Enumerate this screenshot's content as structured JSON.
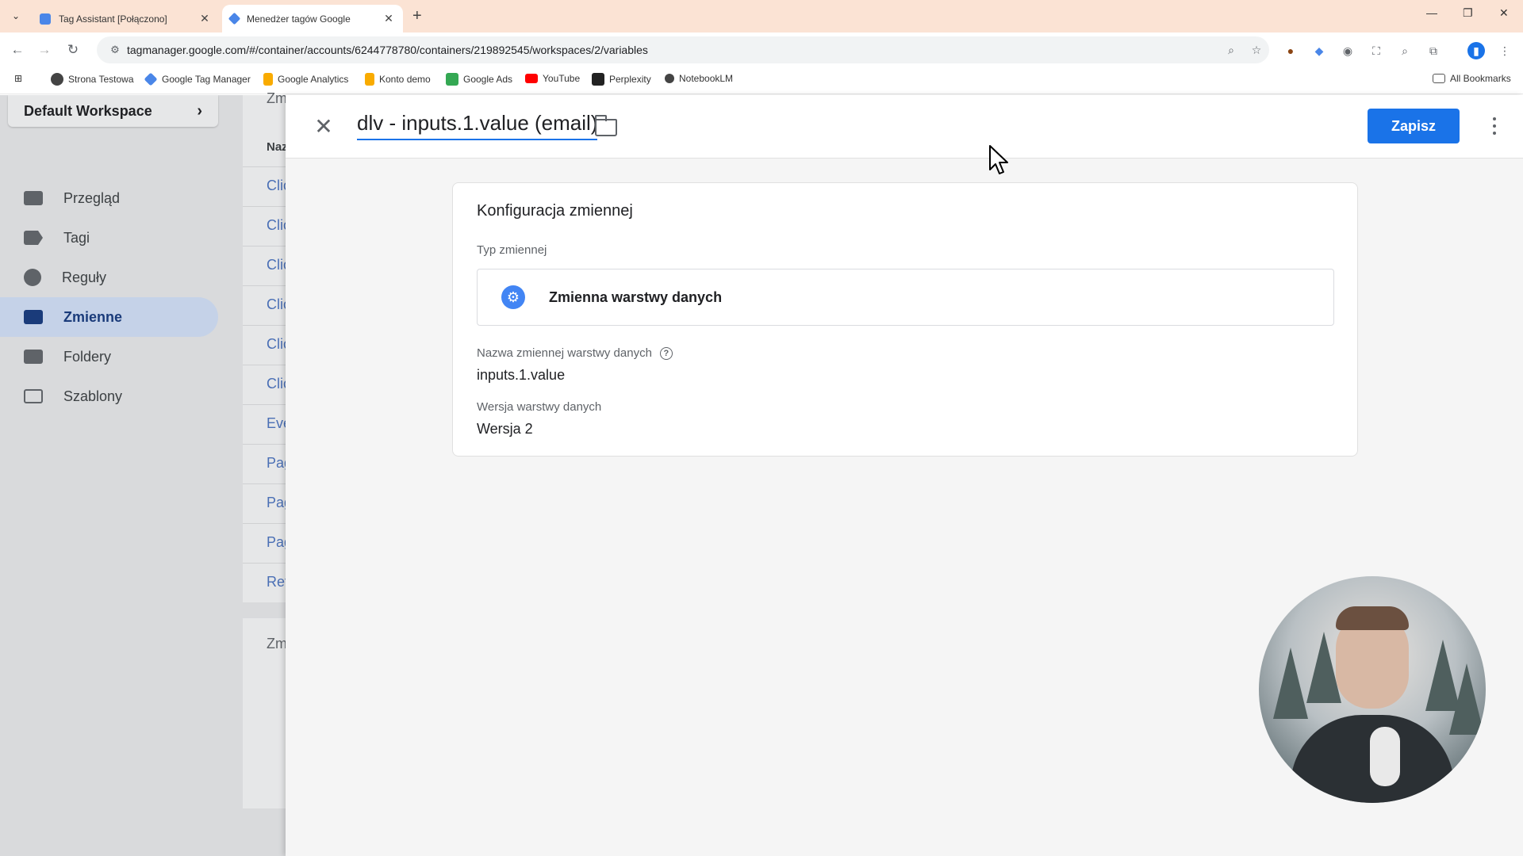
{
  "browser": {
    "tabs": [
      {
        "title": "Tag Assistant [Połączono]",
        "active": false
      },
      {
        "title": "Menedżer tagów Google",
        "active": true
      }
    ],
    "url": "tagmanager.google.com/#/container/accounts/6244778780/containers/219892545/workspaces/2/variables",
    "bookmarks": [
      {
        "label": "Strona Testowa",
        "color": "#444444"
      },
      {
        "label": "Google Tag Manager",
        "color": "#4a86e8"
      },
      {
        "label": "Google Analytics",
        "color": "#f9ab00"
      },
      {
        "label": "Konto demo",
        "color": "#f9ab00"
      },
      {
        "label": "Google Ads",
        "color": "#34a853"
      },
      {
        "label": "YouTube",
        "color": "#ff0000"
      },
      {
        "label": "Perplexity",
        "color": "#222222"
      },
      {
        "label": "NotebookLM",
        "color": "#444444"
      }
    ],
    "all_bookmarks": "All Bookmarks"
  },
  "gtm": {
    "workspace": "Default Workspace",
    "nav": [
      {
        "label": "Przegląd",
        "active": false
      },
      {
        "label": "Tagi",
        "active": false
      },
      {
        "label": "Reguły",
        "active": false
      },
      {
        "label": "Zmienne",
        "active": true
      },
      {
        "label": "Foldery",
        "active": false
      },
      {
        "label": "Szablony",
        "active": false
      }
    ],
    "list_header_top": "Zm",
    "list_column_header": "Naz",
    "list_rows": [
      "Clic",
      "Clic",
      "Clic",
      "Clic",
      "Clic",
      "Clic",
      "Eve",
      "Pag",
      "Pag",
      "Pag",
      "Ref"
    ],
    "list_header_bottom": "Zm"
  },
  "editor": {
    "variable_name": "dlv - inputs.1.value (email)",
    "save_label": "Zapisz",
    "config_title": "Konfiguracja zmiennej",
    "type_label": "Typ zmiennej",
    "type_name": "Zmienna warstwy danych",
    "field1_label": "Nazwa zmiennej warstwy danych",
    "field1_value": "inputs.1.value",
    "field2_label": "Wersja warstwy danych",
    "field2_value": "Wersja 2",
    "accent_color": "#1a73e8"
  }
}
